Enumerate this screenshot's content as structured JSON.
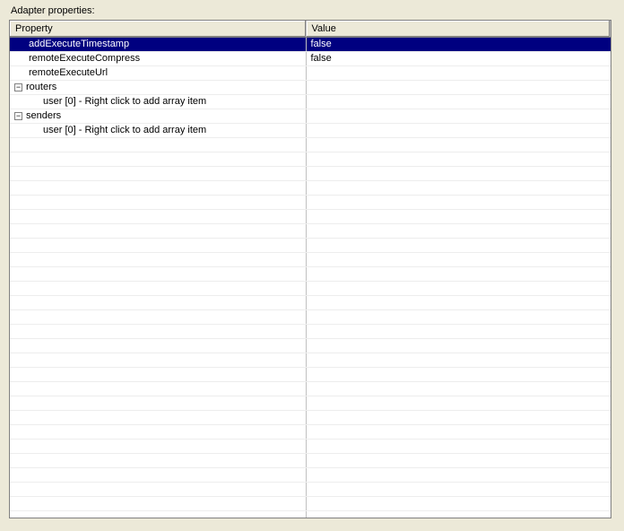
{
  "panel": {
    "label": "Adapter properties:"
  },
  "columns": {
    "property": "Property",
    "value": "Value"
  },
  "rows": [
    {
      "type": "leaf",
      "indent": 1,
      "property": "addExecuteTimestamp",
      "value": "false",
      "selected": true
    },
    {
      "type": "leaf",
      "indent": 1,
      "property": "remoteExecuteCompress",
      "value": "false",
      "selected": false
    },
    {
      "type": "leaf",
      "indent": 1,
      "property": "remoteExecuteUrl",
      "value": "",
      "selected": false
    },
    {
      "type": "group",
      "indent": 0,
      "property": "routers",
      "value": "",
      "expanded": true
    },
    {
      "type": "leaf",
      "indent": 2,
      "property": "user [0]  -  Right click to add array item",
      "value": "",
      "selected": false
    },
    {
      "type": "group",
      "indent": 0,
      "property": "senders",
      "value": "",
      "expanded": true
    },
    {
      "type": "leaf",
      "indent": 2,
      "property": "user [0]  -  Right click to add array item",
      "value": "",
      "selected": false
    }
  ],
  "blank_row_count": 27
}
